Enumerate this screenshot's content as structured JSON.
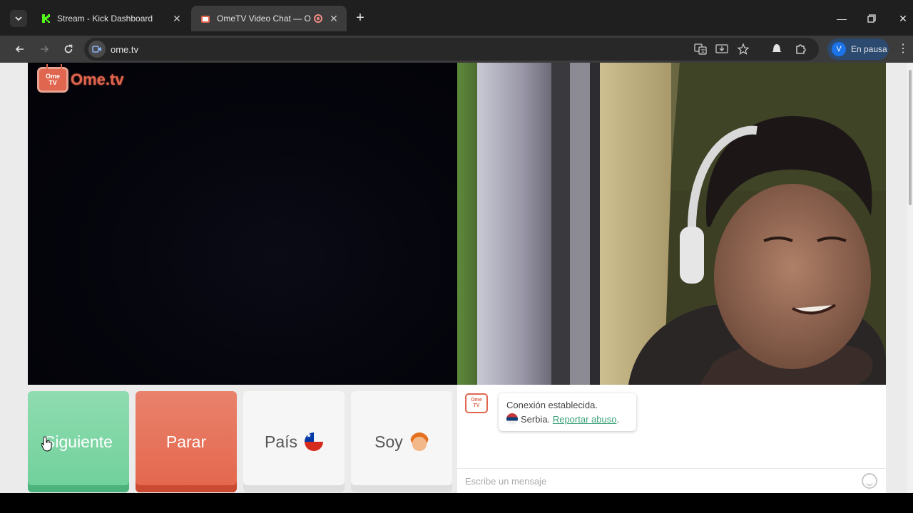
{
  "browser": {
    "tabs": [
      {
        "title": "Stream - Kick Dashboard",
        "favicon": "kick-icon",
        "active": false
      },
      {
        "title": "OmeTV Video Chat — Ome",
        "favicon": "ometv-icon",
        "active": true,
        "recording": true
      }
    ],
    "url": "ome.tv",
    "profile": {
      "initial": "V",
      "status": "En pausa"
    }
  },
  "page": {
    "logo": {
      "badge_line1": "Ome",
      "badge_line2": "TV",
      "text": "Ome.tv"
    },
    "buttons": {
      "next": "Siguiente",
      "stop": "Parar",
      "country": "País",
      "gender": "Soy"
    },
    "chat": {
      "logo_line1": "Ome",
      "logo_line2": "TV",
      "status": "Conexión establecida.",
      "country": "Serbia.",
      "report": "Reportar abuso",
      "report_suffix": ".",
      "placeholder": "Escribe un mensaje"
    }
  },
  "colors": {
    "next_button": "#7fd6a5",
    "stop_button": "#e6735a",
    "brand": "#e0664f",
    "link": "#3aa177"
  }
}
